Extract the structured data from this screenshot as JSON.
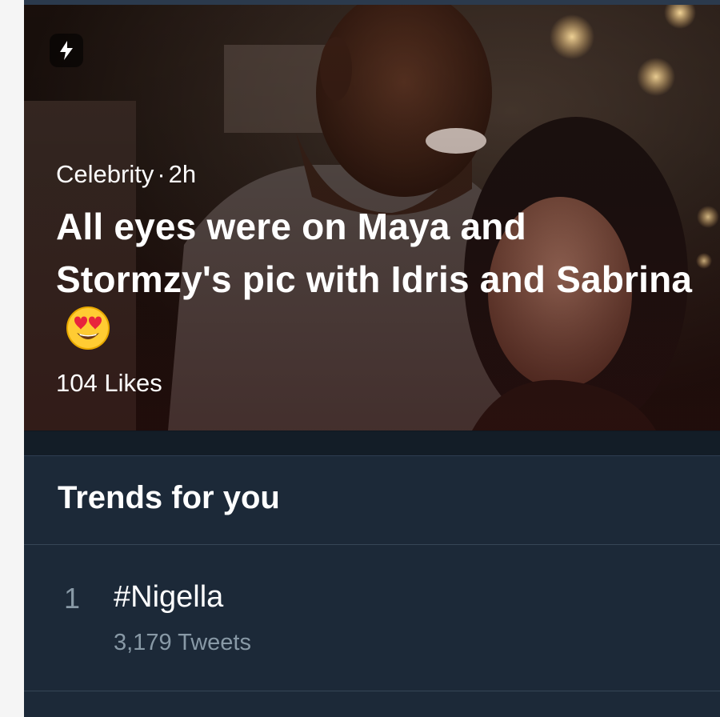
{
  "moment": {
    "badge_icon": "lightning-bolt-icon",
    "category": "Celebrity",
    "separator": "·",
    "time": "2h",
    "headline": "All eyes were on Maya and Stormzy's pic with Idris and Sabrina",
    "headline_emoji": "heart-eyes-emoji",
    "likes": "104 Likes"
  },
  "trends": {
    "title": "Trends for you",
    "items": [
      {
        "rank": "1",
        "name": "#Nigella",
        "count": "3,179 Tweets"
      }
    ]
  },
  "colors": {
    "background": "#1c2938",
    "text_primary": "#ffffff",
    "text_secondary": "#8899a6",
    "divider": "#364656"
  }
}
